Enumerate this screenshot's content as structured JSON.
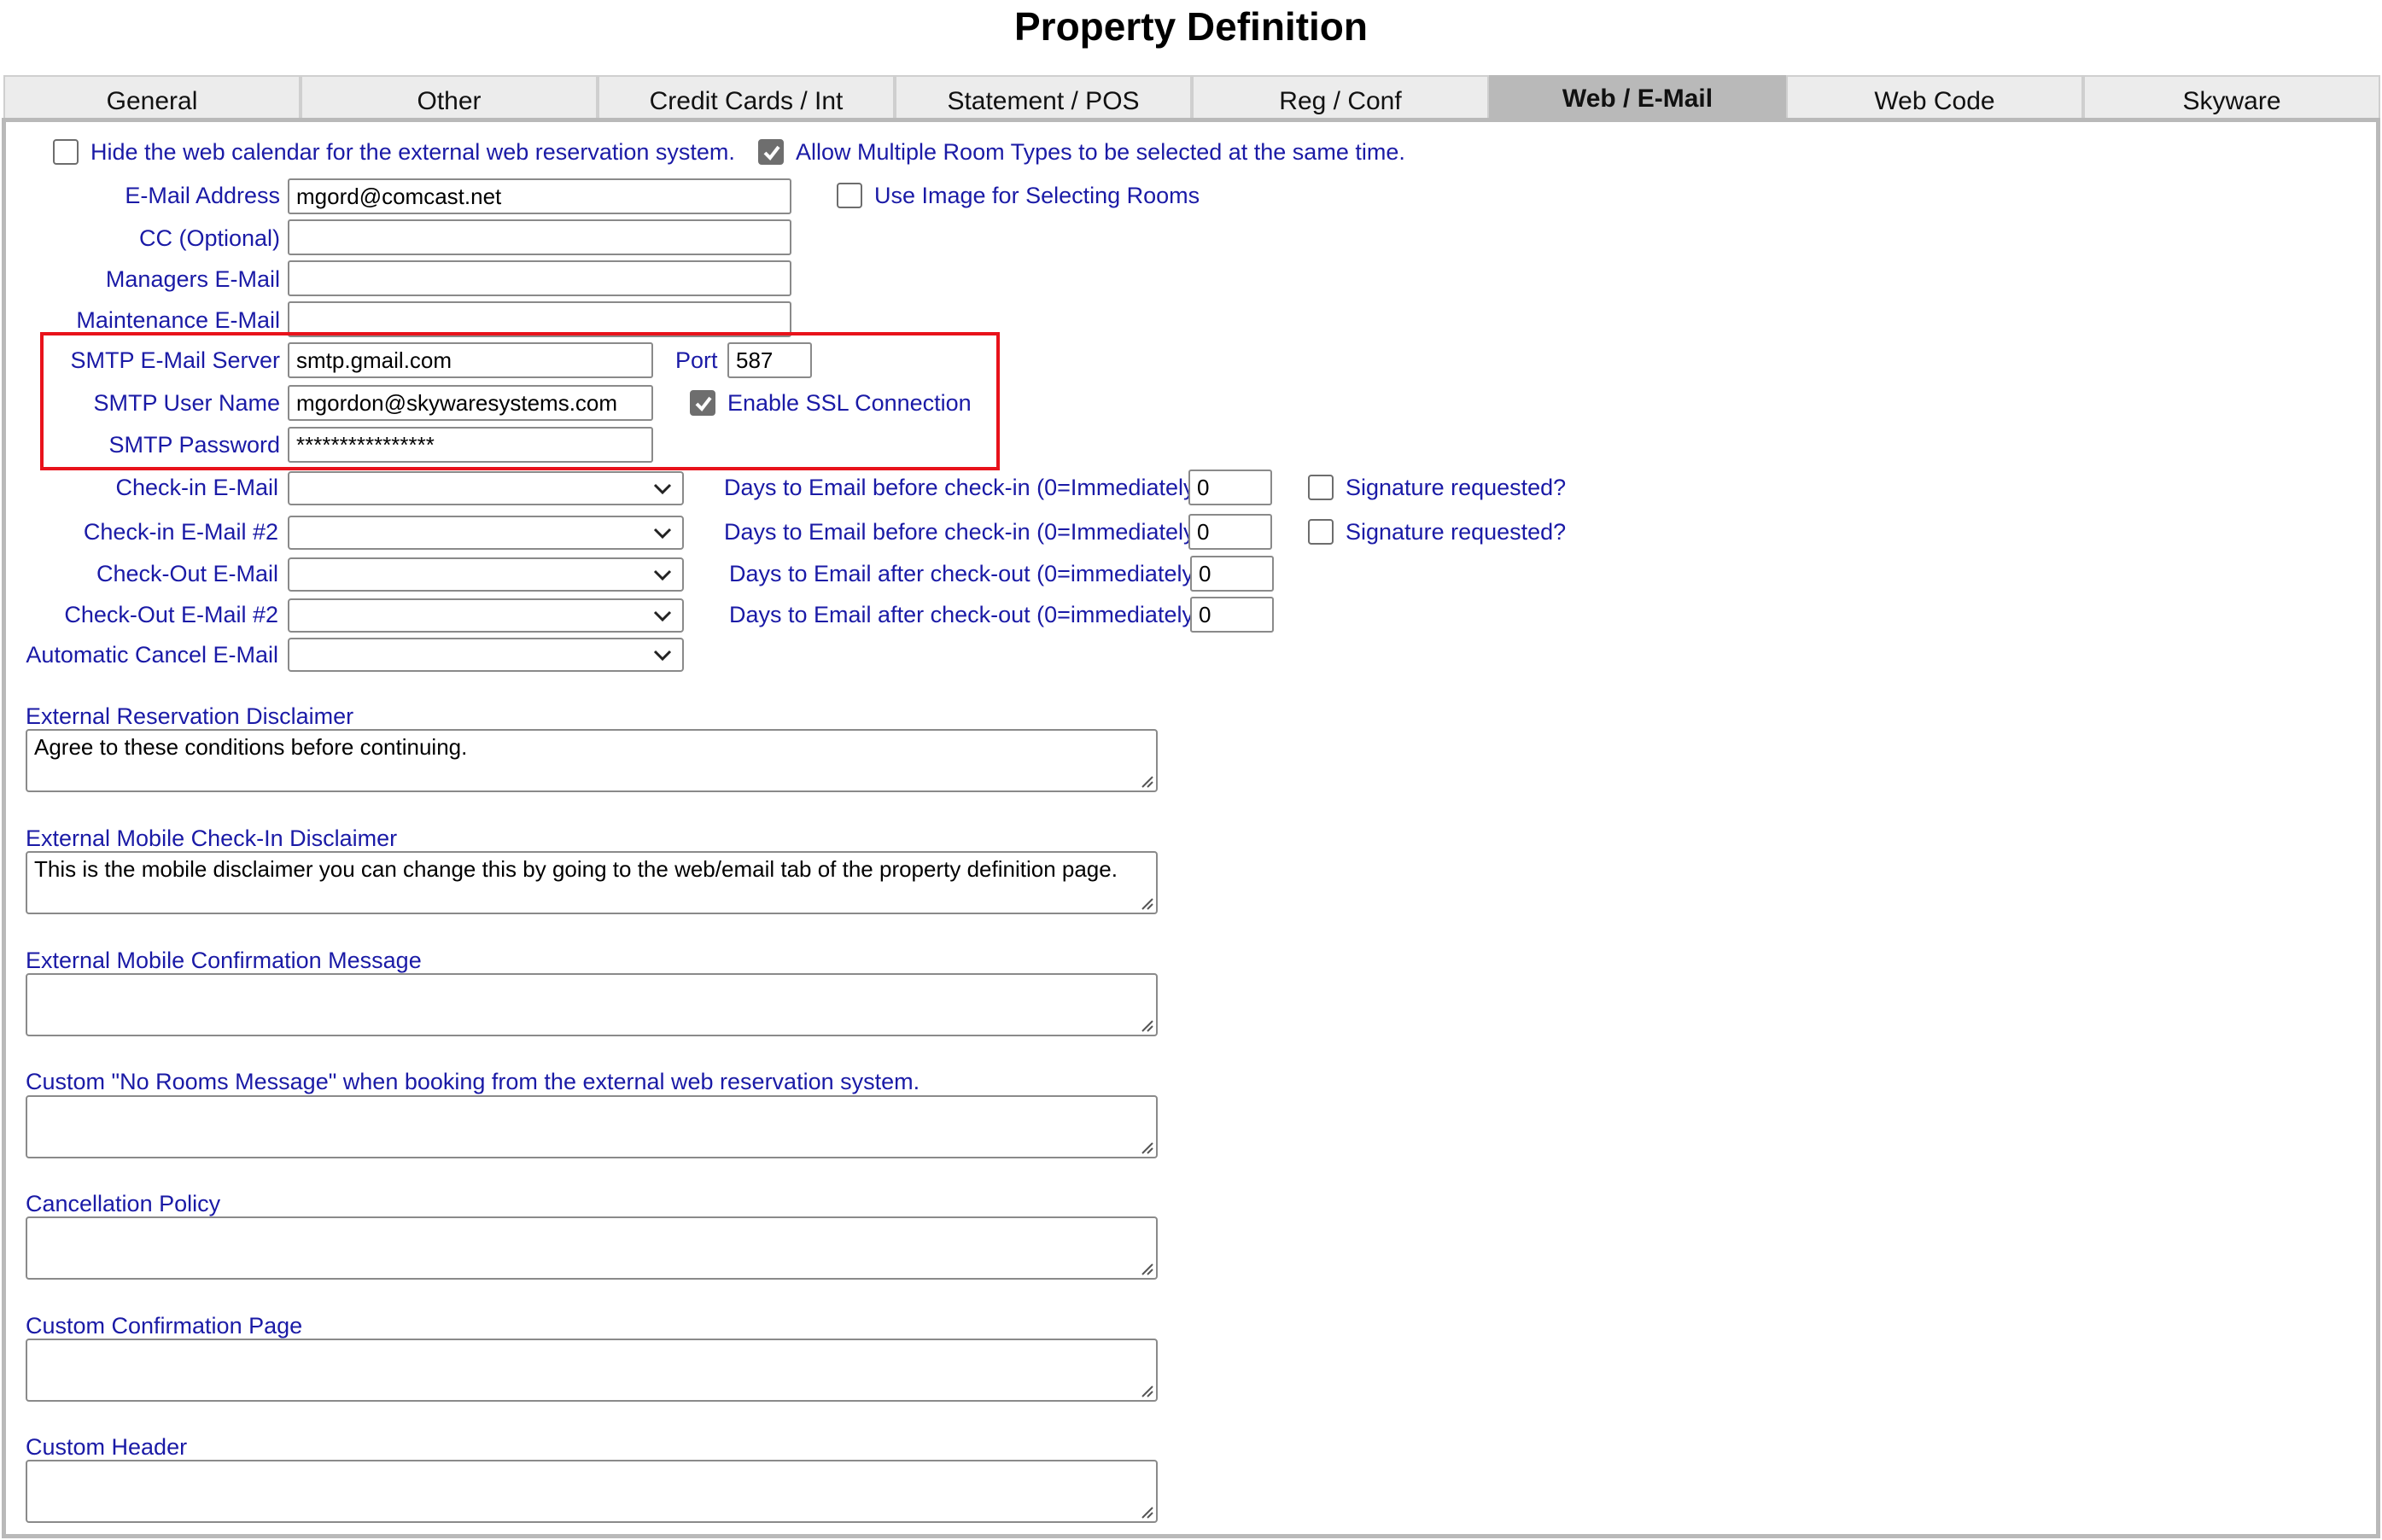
{
  "page_title": "Property Definition",
  "tabs": [
    "General",
    "Other",
    "Credit Cards / Int",
    "Statement / POS",
    "Reg / Conf",
    "Web / E-Mail",
    "Web Code",
    "Skyware"
  ],
  "active_tab": "Web / E-Mail",
  "options": {
    "hide_calendar": {
      "label": "Hide the web calendar for the external web reservation system.",
      "checked": false
    },
    "allow_multiple": {
      "label": "Allow Multiple Room Types to be selected at the same time.",
      "checked": true
    },
    "use_image": {
      "label": "Use Image for Selecting Rooms",
      "checked": false
    }
  },
  "email": {
    "address_label": "E-Mail Address",
    "address_value": "mgord@comcast.net",
    "cc_label": "CC (Optional)",
    "cc_value": "",
    "managers_label": "Managers E-Mail",
    "managers_value": "",
    "maintenance_label": "Maintenance E-Mail",
    "maintenance_value": ""
  },
  "smtp": {
    "server_label": "SMTP E-Mail Server",
    "server_value": "smtp.gmail.com",
    "port_label": "Port",
    "port_value": "587",
    "user_label": "SMTP User Name",
    "user_value": "mgordon@skywaresystems.com",
    "ssl_label": "Enable SSL Connection",
    "ssl_checked": true,
    "password_label": "SMTP Password",
    "password_value": "****************"
  },
  "checkin": {
    "email_label": "Check-in E-Mail",
    "email_value": "",
    "days_label": "Days to Email before check-in (0=Immediately)",
    "days_value": "0",
    "sig_label": "Signature requested?",
    "email2_label": "Check-in E-Mail #2",
    "email2_value": "",
    "days2_label": "Days to Email before check-in (0=Immediately)",
    "days2_value": "0",
    "sig2_label": "Signature requested?"
  },
  "checkout": {
    "email_label": "Check-Out E-Mail",
    "email_value": "",
    "days_label": "Days to Email after check-out (0=immediately)",
    "days_value": "0",
    "email2_label": "Check-Out E-Mail #2",
    "email2_value": "",
    "days2_label": "Days to Email after check-out (0=immediately)",
    "days2_value": "0"
  },
  "auto_cancel": {
    "label": "Automatic Cancel E-Mail",
    "value": ""
  },
  "text_areas": [
    {
      "label": "External Reservation Disclaimer",
      "value": "Agree to these conditions before continuing."
    },
    {
      "label": "External Mobile Check-In Disclaimer",
      "value": "This is the mobile disclaimer you can change this by going to the web/email tab of the property definition page."
    },
    {
      "label": "External Mobile Confirmation Message",
      "value": ""
    },
    {
      "label": "Custom \"No Rooms Message\" when booking from the external web reservation system.",
      "value": ""
    },
    {
      "label": "Cancellation Policy",
      "value": ""
    },
    {
      "label": "Custom Confirmation Page",
      "value": ""
    },
    {
      "label": "Custom Header",
      "value": ""
    }
  ],
  "colors": {
    "label": "#1a1aa6",
    "highlight": "#e8121b",
    "active_tab": "#b9b9b9"
  }
}
